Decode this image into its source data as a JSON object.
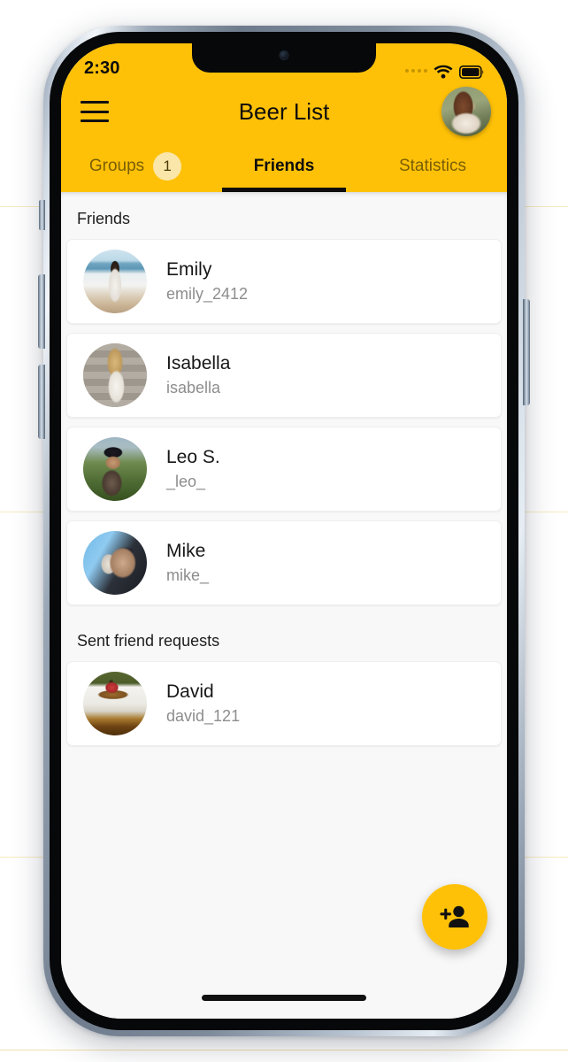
{
  "status_bar": {
    "time": "2:30",
    "signal_icon": "signal-dots-icon",
    "wifi_icon": "wifi-icon",
    "battery_icon": "battery-full-icon"
  },
  "nav": {
    "menu_icon": "hamburger-menu-icon",
    "title": "Beer List",
    "avatar_icon": "user-avatar"
  },
  "tabs": [
    {
      "label": "Groups",
      "badge": "1",
      "active": false
    },
    {
      "label": "Friends",
      "badge": "",
      "active": true
    },
    {
      "label": "Statistics",
      "badge": "",
      "active": false
    }
  ],
  "sections": [
    {
      "label": "Friends",
      "items": [
        {
          "name": "Emily",
          "handle": "emily_2412"
        },
        {
          "name": "Isabella",
          "handle": "isabella"
        },
        {
          "name": "Leo S.",
          "handle": "_leo_"
        },
        {
          "name": "Mike",
          "handle": "mike_"
        }
      ]
    },
    {
      "label": "Sent friend requests",
      "items": [
        {
          "name": "David",
          "handle": "david_121"
        }
      ]
    }
  ],
  "fab": {
    "icon": "person-add-icon",
    "label": "Add friend"
  },
  "colors": {
    "brand_yellow": "#FFC107",
    "badge_bg": "#FAE6A8",
    "content_bg": "#F8F8F8",
    "card_bg": "#FFFFFF",
    "primary_text": "#171717",
    "secondary_text": "#8D8D8D",
    "tab_inactive": "#7A5E06"
  }
}
